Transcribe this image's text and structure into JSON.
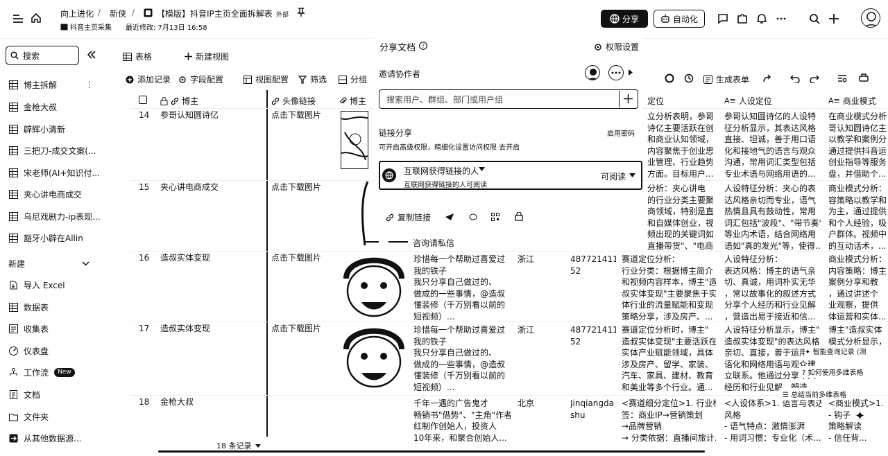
{
  "header": {
    "breadcrumb": [
      "向上进化",
      "新侠"
    ],
    "doc_title": "【模版】抖音IP主页全面拆解表",
    "doc_tag": "外部",
    "subtitle_folder": "抖音主页采集",
    "last_modified": "最近修改: 7月13日 16:58",
    "share_label": "分享",
    "automation_label": "自动化"
  },
  "sidebar": {
    "search_placeholder": "搜索",
    "items": [
      {
        "label": "博主拆解",
        "icon": "grid-icon"
      },
      {
        "label": "金枪大叔",
        "icon": "grid-icon"
      },
      {
        "label": "辟辉小清新",
        "icon": "grid-icon"
      },
      {
        "label": "三把刀-成交文案(...",
        "icon": "grid-icon"
      },
      {
        "label": "宋老师(AI+知识付...",
        "icon": "grid-icon"
      },
      {
        "label": "夹心讲电商成交",
        "icon": "grid-icon"
      },
      {
        "label": "乌尼戏剧力-ip表现...",
        "icon": "grid-icon"
      },
      {
        "label": "豁牙小辟在Allin",
        "icon": "grid-icon"
      }
    ],
    "new_section": "新建",
    "new_items": [
      {
        "label": "导入 Excel",
        "icon": "import-icon"
      },
      {
        "label": "数据表",
        "icon": "table-icon"
      },
      {
        "label": "收集表",
        "icon": "form-icon"
      },
      {
        "label": "仪表盘",
        "icon": "dashboard-icon"
      },
      {
        "label": "工作流",
        "icon": "workflow-icon",
        "badge": "New"
      },
      {
        "label": "文档",
        "icon": "doc-icon"
      },
      {
        "label": "文件夹",
        "icon": "folder-icon"
      },
      {
        "label": "从其他数据源...",
        "icon": "datasource-icon"
      }
    ]
  },
  "toolbar": {
    "view_label": "表格",
    "new_view": "新建视图",
    "add_record": "添加记录",
    "field_config": "字段配置",
    "view_config": "视图配置",
    "filter": "筛选",
    "group": "分组",
    "generate_form": "生成表单"
  },
  "table": {
    "columns": [
      "博主",
      "头像链接",
      "博主",
      "定位",
      "人设定位",
      "商业模式"
    ],
    "rows": [
      {
        "num": "14",
        "name": "参哥认知圆诗亿",
        "link": "点击下载图片",
        "pos": [
          "立分析表明，参哥",
          "诗亿主要活跃在创",
          "和商业认知领域，",
          "内容聚焦于创业思",
          "业管理、行业趋势",
          "方面。目标用户..."
        ],
        "persona": [
          "参哥认知圆诗亿的人设特",
          "征分析显示，其表达风格",
          "直接、坦诚，善于用口语",
          "化和接地气的语言与观众",
          "沟通，常用词汇类型包括",
          "专业术语与网络用语的..."
        ],
        "biz": [
          "在商业模式分析",
          "哥认知圆诗亿主",
          "以教学和案例分",
          "通过提供抖音运",
          "创业指导等服务",
          "盘，并借助个..."
        ]
      },
      {
        "num": "15",
        "name": "夹心讲电商成交",
        "link": "点击下载图片",
        "pos": [
          "分析：夹心讲电",
          "的行业分类主要聚",
          "商领域，特别是直",
          "和自媒体创业，视",
          "频出现的关键词如",
          "直播带货\"、\"电商干货\"..."
        ],
        "persona": [
          "人设特征分析：夹心的表",
          "达风格亲切而专业，语气",
          "热情且具有鼓动性，常用",
          "词汇包括\"波段\"、\"带节奏\"",
          "等业内术语，结合网络用",
          "语如\"真的发光\"等，使得..."
        ],
        "biz": [
          "商业模式分析：",
          "容策略以教学和",
          "为主，通过提供",
          "和个人经验，吸",
          "户群体。视频中",
          "的互动话术，..."
        ]
      },
      {
        "num": "16",
        "name": "造叔实体变现",
        "link": "点击下载图片",
        "caption": [
          "珍惜每一个帮助过喜爱过",
          "我的铁子",
          "我只分享自己做过的、",
          "做成的一些事情，@造叔",
          "懂装修（千万别看以前的",
          "短视频）..."
        ],
        "region": "浙江",
        "uid": [
          "487721411",
          "52"
        ],
        "pos": [
          "赛道定位分析：",
          "行业分类：根据博主简介",
          "和视频内容样本，博主\"造",
          "叔实体变现\"主要聚焦于实",
          "体行业的流量赋能和变现",
          "策略分享，涉及房产、..."
        ],
        "persona": [
          "人设特征分析：",
          "表达风格：博主的语气亲",
          "切、真诚，用词朴实无华",
          "，常以故事化的叙述方式",
          "分享个人经历和行业见解",
          "，营造出易于接近和信..."
        ],
        "biz": [
          "商业模式分析：",
          "内容策略：博主",
          "案例分享和教",
          "，通过讲述个",
          "业观察，提供",
          "体运营和实体..."
        ]
      },
      {
        "num": "17",
        "name": "造叔实体变现",
        "link": "点击下载图片",
        "caption": [
          "珍惜每一个帮助过喜爱过",
          "我的铁子",
          "我只分享自己做过的、",
          "做成的一些事情，@造叔",
          "懂装修（千万别看以前的",
          "短视频）..."
        ],
        "region": "浙江",
        "uid": [
          "487721411",
          "52"
        ],
        "pos": [
          "赛道定位分析时，博主\"",
          "造叔实体变现\"主要活跃在",
          "实体产业赋能领域，具体",
          "涉及房产、留学、家装、",
          "汽车、家具、建材、教育",
          "和美业等多个行业。通..."
        ],
        "persona": [
          "人设特征分析显示，博主\"",
          "造叔实体变现\"的表达风格",
          "亲切、直接，善于运用口",
          "语化和网络用语与观众建",
          "立联系。他通过分享个人",
          "经历和行业见解，塑造..."
        ],
        "biz": [
          "博主\"造叔实体",
          "模式分析显示，"
        ]
      },
      {
        "num": "18",
        "name": "金枪大叔",
        "link": "",
        "caption": [
          "千年一遇的广告鬼才",
          "畅销书\"借势\"、\"主角\"作者",
          "红制作创始人，投资人",
          "10年来，和聚合创始人..."
        ],
        "region": "北京",
        "uid": [
          "Jinqiangda",
          "shu"
        ],
        "pos": [
          "<赛道细分定位>1. 行业标",
          "签：商业IP→营销策划",
          "→品牌营销",
          "→ 分类依据：直播间旅计..."
        ],
        "persona": [
          "<人设体系>1. 语言与表达",
          "风格",
          "- 语气特点：激情澎湃",
          "- 用词习惯：专业化（术..."
        ],
        "biz": [
          "<商业模式>1.",
          "- 钩子",
          "策略解读",
          "- 信任背..."
        ]
      }
    ],
    "record_count": "18 条记录"
  },
  "share_panel": {
    "title": "分享文档",
    "permission_settings": "权限设置",
    "invite_label": "邀请协作者",
    "search_placeholder": "搜索用户、群组、部门或用户组",
    "link_share_title": "链接分享",
    "link_share_desc": "可开启高级权限，精细化设置访问权限 去开启",
    "password_label": "启用密码",
    "perm_title": "互联网获得链接的人",
    "perm_desc": "互联网获得链接的人可阅读",
    "perm_level": "可阅读",
    "copy_link": "复制链接",
    "consult_label": "咨询请私信"
  },
  "floating": {
    "smart_log": "智能查询记录 (测",
    "learn_multi": "如何使用多维表格",
    "summary": "总结当前多维表格"
  }
}
